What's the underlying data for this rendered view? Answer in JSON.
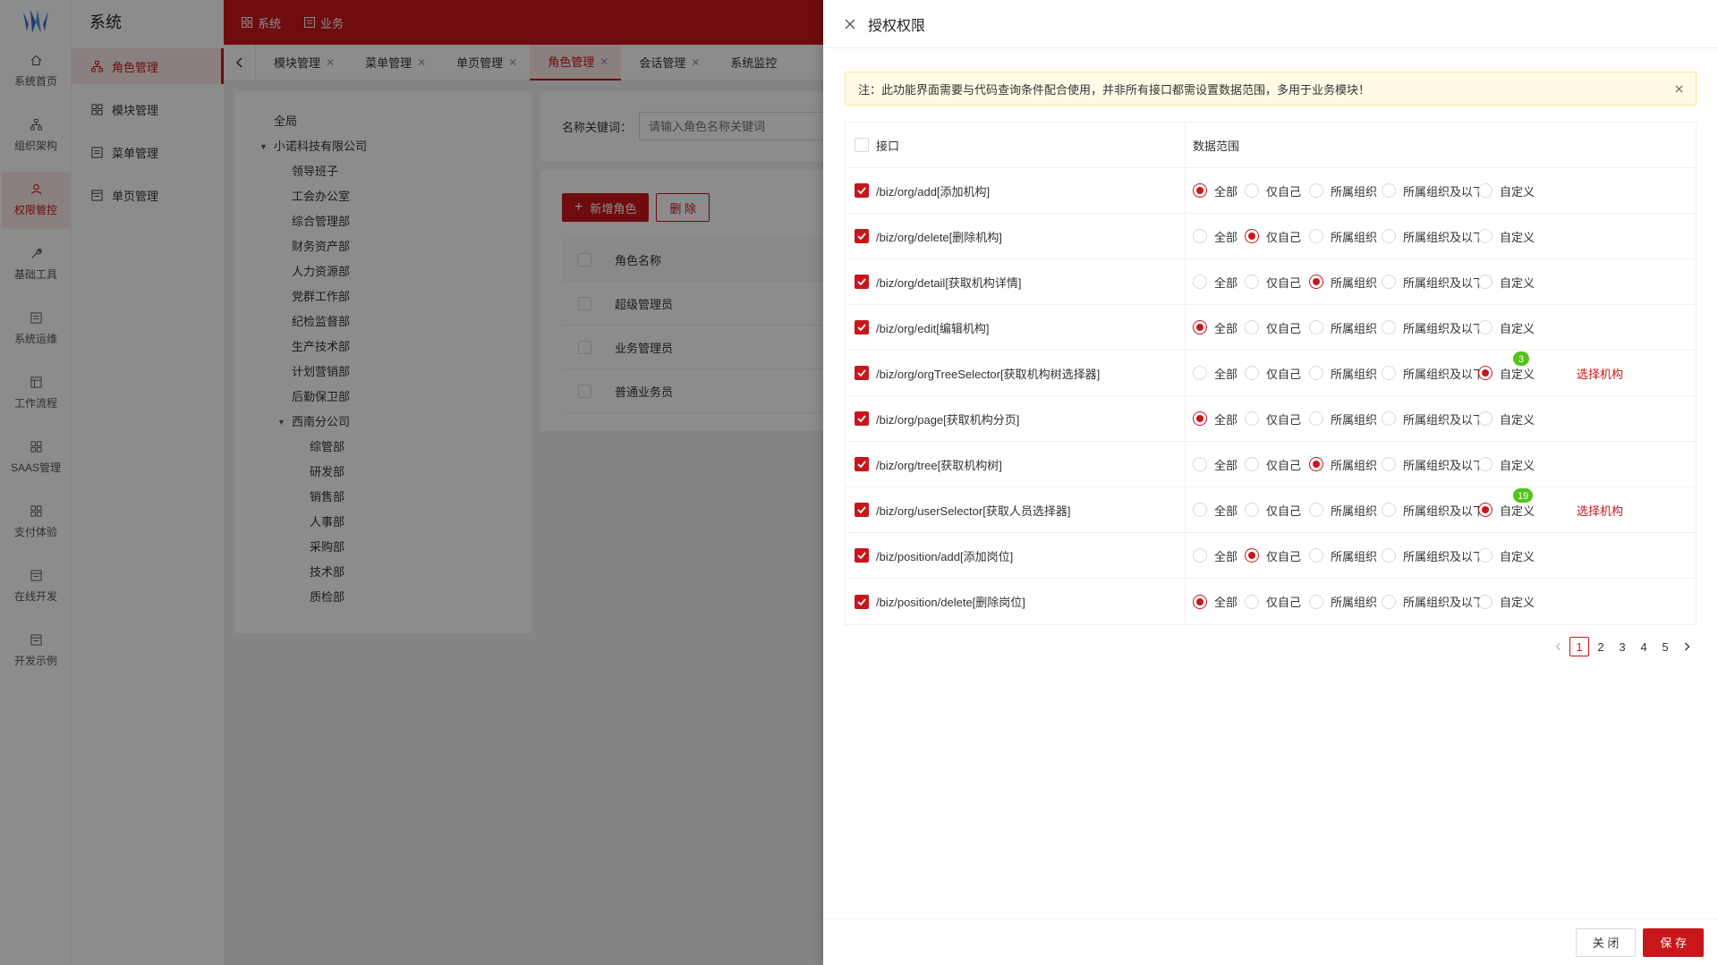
{
  "brand": {
    "accent": "#c8161d"
  },
  "rail": {
    "items": [
      {
        "label": "系统首页",
        "icon": "home-icon"
      },
      {
        "label": "组织架构",
        "icon": "org-tree-icon"
      },
      {
        "label": "权限管控",
        "icon": "user-icon",
        "active": true
      },
      {
        "label": "基础工具",
        "icon": "wrench-icon"
      },
      {
        "label": "系统运维",
        "icon": "monitor-icon"
      },
      {
        "label": "工作流程",
        "icon": "workflow-icon"
      },
      {
        "label": "SAAS管理",
        "icon": "grid-icon"
      },
      {
        "label": "支付体验",
        "icon": "grid-icon"
      },
      {
        "label": "在线开发",
        "icon": "window-icon"
      },
      {
        "label": "开发示例",
        "icon": "window-icon"
      }
    ]
  },
  "menu": {
    "title": "系统",
    "items": [
      {
        "label": "角色管理",
        "active": true
      },
      {
        "label": "模块管理"
      },
      {
        "label": "菜单管理"
      },
      {
        "label": "单页管理"
      }
    ]
  },
  "topbar": {
    "nav": [
      "系统",
      "业务"
    ]
  },
  "tabs": [
    {
      "label": "模块管理"
    },
    {
      "label": "菜单管理"
    },
    {
      "label": "单页管理"
    },
    {
      "label": "角色管理",
      "active": true
    },
    {
      "label": "会话管理"
    },
    {
      "label": "系统监控"
    }
  ],
  "tree": [
    {
      "label": "全局",
      "level": 0
    },
    {
      "label": "小诺科技有限公司",
      "level": 0,
      "expanded": true
    },
    {
      "label": "领导班子",
      "level": 1
    },
    {
      "label": "工会办公室",
      "level": 1
    },
    {
      "label": "综合管理部",
      "level": 1
    },
    {
      "label": "财务资产部",
      "level": 1
    },
    {
      "label": "人力资源部",
      "level": 1
    },
    {
      "label": "党群工作部",
      "level": 1
    },
    {
      "label": "纪检监督部",
      "level": 1
    },
    {
      "label": "生产技术部",
      "level": 1
    },
    {
      "label": "计划营销部",
      "level": 1
    },
    {
      "label": "后勤保卫部",
      "level": 1
    },
    {
      "label": "西南分公司",
      "level": 1,
      "expanded": true
    },
    {
      "label": "综管部",
      "level": 2
    },
    {
      "label": "研发部",
      "level": 2
    },
    {
      "label": "销售部",
      "level": 2
    },
    {
      "label": "人事部",
      "level": 2
    },
    {
      "label": "采购部",
      "level": 2
    },
    {
      "label": "技术部",
      "level": 2
    },
    {
      "label": "质检部",
      "level": 2
    }
  ],
  "search": {
    "label": "名称关键词：",
    "placeholder": "请输入角色名称关键词"
  },
  "roles": {
    "add_label": "新增角色",
    "delete_label": "删 除",
    "column_header": "角色名称",
    "rows": [
      "超级管理员",
      "业务管理员",
      "普通业务员"
    ]
  },
  "drawer": {
    "title": "授权权限",
    "notice": "注：此功能界面需要与代码查询条件配合使用，并非所有接口都需设置数据范围，多用于业务模块！",
    "col_api": "接口",
    "col_scope": "数据范围",
    "scope_options": [
      "全部",
      "仅自己",
      "所属组织",
      "所属组织及以下",
      "自定义"
    ],
    "select_org_label": "选择机构",
    "rows": [
      {
        "api": "/biz/org/add[添加机构]",
        "scope": 0
      },
      {
        "api": "/biz/org/delete[删除机构]",
        "scope": 1
      },
      {
        "api": "/biz/org/detail[获取机构详情]",
        "scope": 2
      },
      {
        "api": "/biz/org/edit[编辑机构]",
        "scope": 0
      },
      {
        "api": "/biz/org/orgTreeSelector[获取机构树选择器]",
        "scope": 4,
        "badge": "3"
      },
      {
        "api": "/biz/org/page[获取机构分页]",
        "scope": 0
      },
      {
        "api": "/biz/org/tree[获取机构树]",
        "scope": 2
      },
      {
        "api": "/biz/org/userSelector[获取人员选择器]",
        "scope": 4,
        "badge": "19"
      },
      {
        "api": "/biz/position/add[添加岗位]",
        "scope": 1
      },
      {
        "api": "/biz/position/delete[删除岗位]",
        "scope": 0
      }
    ],
    "pages": [
      "1",
      "2",
      "3",
      "4",
      "5"
    ],
    "current_page": "1",
    "close_label": "关 闭",
    "save_label": "保 存"
  }
}
